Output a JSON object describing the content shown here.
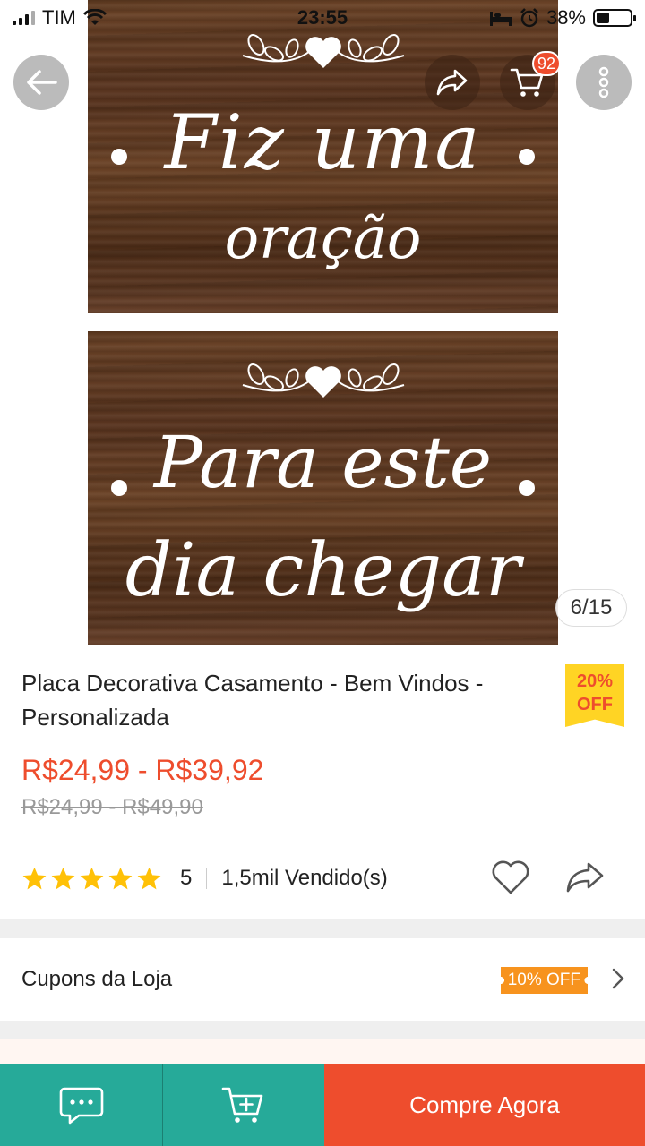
{
  "status_bar": {
    "carrier": "TIM",
    "time": "23:55",
    "battery": "38%",
    "battery_level": 0.38
  },
  "gallery": {
    "image_1_line_1": "Fiz uma",
    "image_1_line_2": "oração",
    "image_2_line_1": "Para este",
    "image_2_line_2": "dia chegar",
    "page_counter": "6/15",
    "cart_count": "92"
  },
  "product": {
    "title": "Placa Decorativa Casamento - Bem Vindos - Personalizada",
    "discount_line_1": "20%",
    "discount_line_2": "OFF",
    "price": "R$24,99 - R$39,92",
    "original_price": "R$24,99 - R$49,90",
    "rating": "5",
    "stars": 5,
    "sold": "1,5mil Vendido(s)"
  },
  "coupons": {
    "label": "Cupons da Loja",
    "tag": "10% OFF"
  },
  "bottom_bar": {
    "buy_now": "Compre Agora"
  },
  "colors": {
    "brand": "#ee4d2d",
    "teal": "#26aa99",
    "star": "#ffc107",
    "badge": "#ffd424",
    "coupon": "#f7931e"
  }
}
